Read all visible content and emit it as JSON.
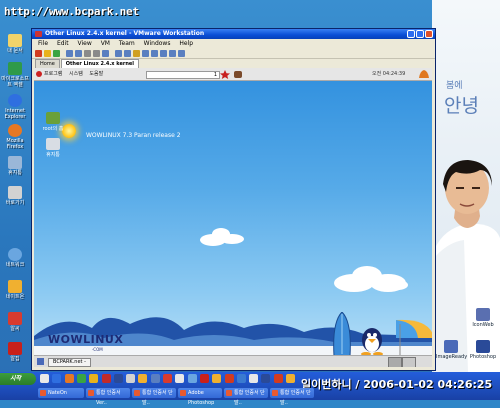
{
  "watermark": "http://www.bcpark.net",
  "desktop": {
    "icons": [
      {
        "label": "내 문서",
        "color": "#f1d36a",
        "icon": "folder-icon"
      },
      {
        "label": "마이크로소프트 엑셀",
        "color": "#2f9a49",
        "icon": "excel-icon"
      },
      {
        "label": "Internet Explorer",
        "color": "#2f6fe0",
        "icon": "ie-icon"
      },
      {
        "label": "Mozilla Firefox",
        "color": "#e67824",
        "icon": "firefox-icon"
      },
      {
        "label": "휴지통",
        "color": "#9ab7d8",
        "icon": "recycle-icon"
      },
      {
        "label": "바로가기",
        "color": "#d2d2d2",
        "icon": "shortcut-icon"
      },
      {
        "label": "네트워크",
        "color": "#6aa6e0",
        "icon": "network-icon"
      },
      {
        "label": "네이트온",
        "color": "#f0b030",
        "icon": "nate-icon"
      },
      {
        "label": "알씨",
        "color": "#d83b2f",
        "icon": "alsee-icon"
      },
      {
        "label": "알집",
        "color": "#c9201a",
        "icon": "alzip-icon"
      }
    ],
    "right_icons": [
      {
        "label": "IconWeb",
        "icon": "app-icon"
      },
      {
        "label": "ImageReady",
        "icon": "imageready-icon"
      },
      {
        "label": "Photoshop",
        "icon": "photoshop-icon"
      }
    ],
    "hangul_small": "봄에",
    "hangul_big": "안녕"
  },
  "vmware": {
    "title": "Other Linux 2.4.x kernel - VMware Workstation",
    "menu": [
      "File",
      "Edit",
      "View",
      "VM",
      "Team",
      "Windows",
      "Help"
    ],
    "tabs": [
      "Home",
      "Other Linux 2.4.x kernel"
    ],
    "toolbar_colors": [
      "#d23b1f",
      "#e8b21c",
      "#3aa442",
      "#5a7fc0",
      "#5a7fc0",
      "#8a8a8a",
      "#8a8a8a",
      "#5a7fc0",
      "#5a7fc0",
      "#5a7fc0",
      "#d0a020",
      "#5a7fc0",
      "#5a7fc0",
      "#5a7fc0",
      "#5a7fc0",
      "#5a7fc0"
    ]
  },
  "guest": {
    "panel_menu": [
      "프로그램",
      "시스템",
      "도움말"
    ],
    "panel_field_value": "1",
    "clock": "오전 04:24:39",
    "icons": [
      {
        "label": "root의 홈",
        "icon": "home-icon"
      },
      {
        "label": "휴지통",
        "icon": "trash-icon"
      }
    ],
    "release": "WOWLINUX 7.3 Paran release 2",
    "logo_main": "WOW",
    "logo_linux": "LINUX",
    "logo_sub": "·COM",
    "task": "BCPARK.net -"
  },
  "taskbar": {
    "start": "시작",
    "clock_text": "일이번하니 / 2006-01-02 04:26:25",
    "tasks": [
      "NateOn",
      "통합 인증서 Ver..",
      "통합 인증서 단말..",
      "Adobe Photoshop",
      "통합 인증서 단말..",
      "통합 인증서 단말.."
    ]
  }
}
